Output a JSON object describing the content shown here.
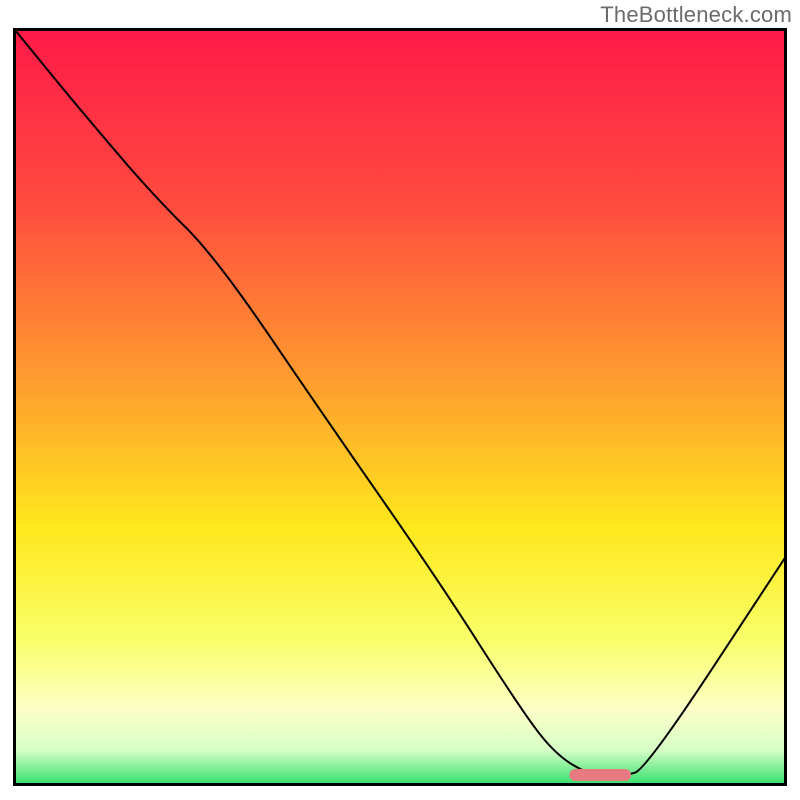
{
  "watermark": "TheBottleneck.com",
  "chart_data": {
    "type": "line",
    "title": "",
    "xlabel": "",
    "ylabel": "",
    "xlim": [
      0,
      100
    ],
    "ylim": [
      0,
      100
    ],
    "gradient_stops": [
      {
        "offset": 0,
        "color": "#ff1a49"
      },
      {
        "offset": 0.23,
        "color": "#ff4b3f"
      },
      {
        "offset": 0.47,
        "color": "#ff9e2e"
      },
      {
        "offset": 0.66,
        "color": "#ffe81c"
      },
      {
        "offset": 0.81,
        "color": "#f9ff6a"
      },
      {
        "offset": 0.9,
        "color": "#fdffc6"
      },
      {
        "offset": 0.955,
        "color": "#d6ffc6"
      },
      {
        "offset": 1.0,
        "color": "#36e06f"
      }
    ],
    "series": [
      {
        "name": "bottleneck-curve",
        "x": [
          0,
          8,
          18,
          26,
          40,
          55,
          65,
          70,
          75,
          79,
          82,
          100
        ],
        "y": [
          100,
          90,
          78,
          70,
          49,
          27,
          11,
          4,
          1,
          1,
          2,
          30
        ]
      }
    ],
    "marker": {
      "x_start": 72,
      "x_end": 80,
      "y": 1.2,
      "color": "#e77a80"
    },
    "frame_stroke": "#000000",
    "frame_stroke_width": 3,
    "curve_stroke": "#000000",
    "curve_stroke_width": 2
  }
}
